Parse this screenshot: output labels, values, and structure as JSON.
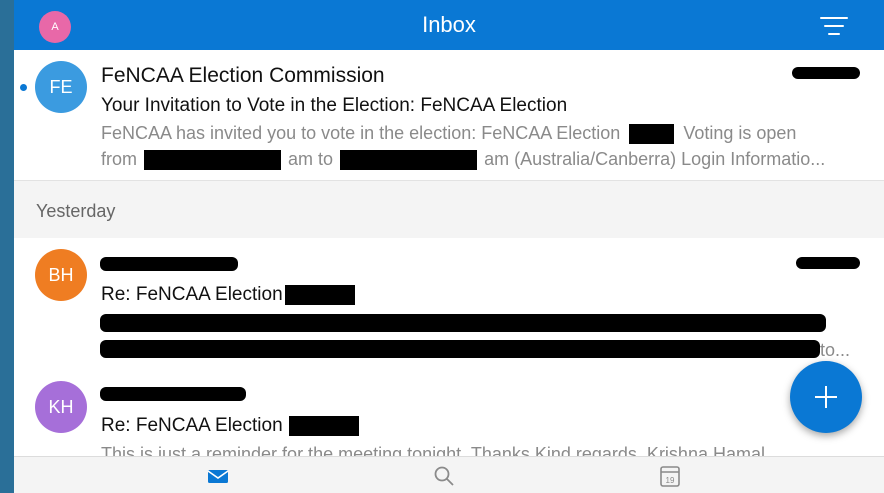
{
  "header": {
    "title": "Inbox",
    "avatar_initial": "A",
    "filter_icon": "filter-icon"
  },
  "colors": {
    "header": "#0a78d4",
    "avatar_fe": "#3b9be0",
    "avatar_bh": "#ef7d22",
    "avatar_kh": "#a66fd9",
    "fab": "#0a78d4"
  },
  "emails": [
    {
      "initials": "FE",
      "sender": "FeNCAA Election Commission",
      "subject": "Your Invitation to Vote in the Election: FeNCAA Election",
      "preview_line1_a": "FeNCAA has invited you to vote in the election: FeNCAA Election",
      "preview_line1_b": "Voting is open",
      "preview_line2_a": "from",
      "preview_line2_b": "am to",
      "preview_line2_c": "am (Australia/Canberra) Login Informatio..."
    },
    {
      "initials": "BH",
      "subject": "Re: FeNCAA Election",
      "preview_tail": "to..."
    },
    {
      "initials": "KH",
      "subject": "Re: FeNCAA Election",
      "preview": "This is just a reminder for the meeting tonight. Thanks Kind regards, Krishna Hamal"
    }
  ],
  "section_label": "Yesterday",
  "fab": {
    "icon": "plus-icon"
  },
  "bottom_nav": {
    "mail_icon": "mail-icon",
    "search_icon": "search-icon",
    "calendar_icon": "calendar-icon",
    "calendar_day": "19"
  }
}
